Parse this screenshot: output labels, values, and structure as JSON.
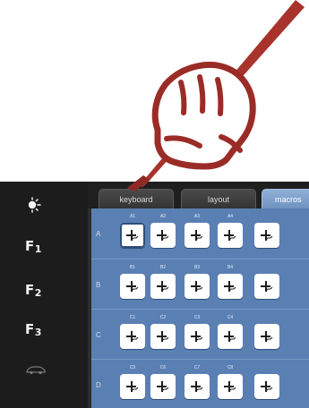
{
  "illustration": {
    "hand_icon": "writing-hand-icon",
    "stylus_icon": "stylus-icon",
    "stroke_color": "#9a2c27"
  },
  "sidebar": {
    "items": [
      {
        "icon": "brightness-icon"
      },
      {
        "label": "F",
        "sub": "1"
      },
      {
        "label": "F",
        "sub": "2"
      },
      {
        "label": "F",
        "sub": "3"
      },
      {
        "icon": "car-icon"
      }
    ]
  },
  "tabs": [
    {
      "label": "keyboard"
    },
    {
      "label": "layout"
    },
    {
      "label": "macros"
    }
  ],
  "macro_grid": {
    "accent": "#5a7fb3",
    "rows": [
      {
        "letter": "A",
        "cells": [
          "A1",
          "A2",
          "A3",
          "A4",
          ""
        ]
      },
      {
        "letter": "B",
        "cells": [
          "B1",
          "B2",
          "B3",
          "B4",
          ""
        ]
      },
      {
        "letter": "C",
        "cells": [
          "C1",
          "C2",
          "C3",
          "C4",
          ""
        ]
      },
      {
        "letter": "D",
        "cells": [
          "C5",
          "C6",
          "C7",
          "C8",
          ""
        ]
      }
    ],
    "key_icon": "macro-key-icon"
  }
}
